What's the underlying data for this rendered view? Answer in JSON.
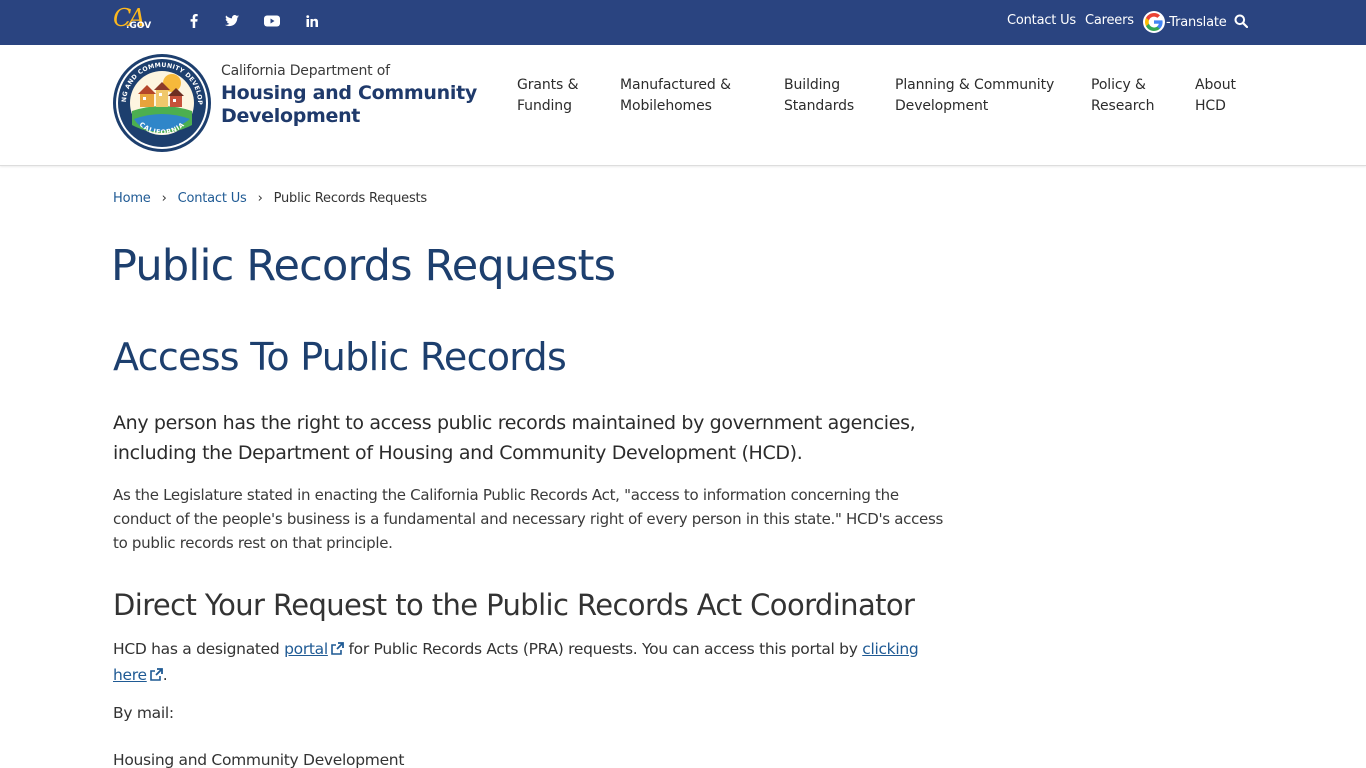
{
  "utility": {
    "logo_ca": "CA",
    "logo_gov": ".GOV",
    "social": [
      "facebook-icon",
      "twitter-icon",
      "youtube-icon",
      "linkedin-icon"
    ],
    "contact_label": "Contact Us",
    "careers_label": "Careers",
    "translate_label": "-Translate",
    "search_icon": "search-icon",
    "bg_color": "#2a4480"
  },
  "header": {
    "org_line1": "California Department of",
    "org_line2": "Housing and Community",
    "org_line3": "Development",
    "seal_top": "HOUSING AND COMMUNITY DEVELOPMENT",
    "seal_bottom": "CALIFORNIA",
    "nav": [
      {
        "line1": "Grants &",
        "line2": "Funding"
      },
      {
        "line1": "Manufactured &",
        "line2": "Mobilehomes"
      },
      {
        "line1": "Building",
        "line2": "Standards"
      },
      {
        "line1": "Planning & Community",
        "line2": "Development"
      },
      {
        "line1": "Policy &",
        "line2": "Research"
      },
      {
        "line1": "About",
        "line2": "HCD"
      }
    ]
  },
  "breadcrumb": {
    "home": "Home",
    "contact": "Contact Us",
    "current": "Public Records Requests",
    "sep": "›"
  },
  "main": {
    "page_title": "Public Records Requests",
    "h2": "Access To Public Records",
    "lead": "Any person has the right to access public records maintained by government agencies, including the Department of Housing and Community Development (HCD).",
    "para": "As the Legislature stated in enacting the California Public Records Act, \"access to information concerning the conduct of the people's business is a fundamental and necessary right of every person in this state.\" HCD's access to public records rest on that principle.",
    "h3": "Direct Your Request to the Public Records Act Coordinator",
    "para2_a": "HCD has a designated ",
    "portal_link": "portal",
    "para2_b": " for Public Records Acts (PRA) requests. You can access this portal by ",
    "clicking_here_1": "clicking",
    "clicking_here_2": "here",
    "para2_end": ".",
    "by_mail": "By mail:",
    "address_line1": "Housing and Community Development"
  },
  "colors": {
    "heading": "#1d3f6e",
    "link": "#1f5a94",
    "accent": "#fdb81e"
  }
}
